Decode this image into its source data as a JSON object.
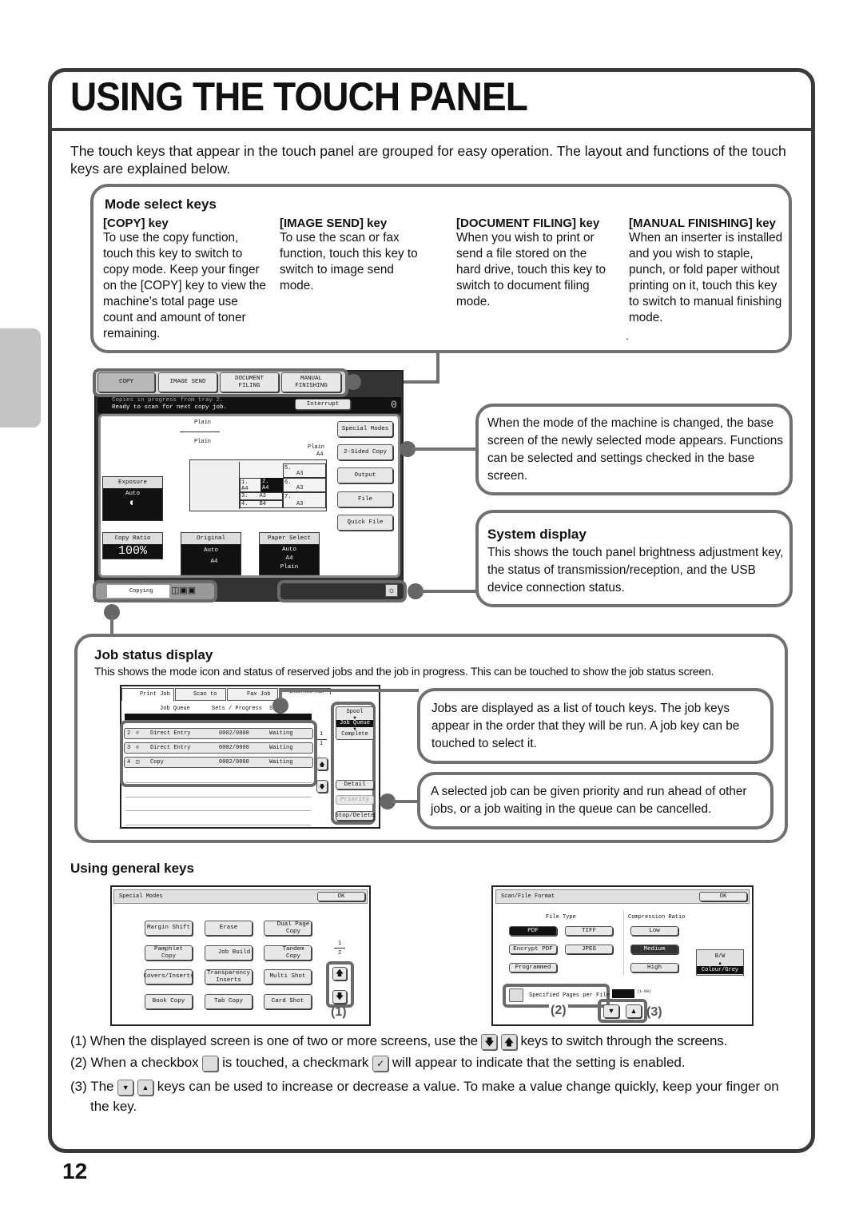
{
  "page": {
    "title": "USING THE TOUCH PANEL",
    "intro": "The touch keys that appear in the touch panel are grouped for easy operation. The layout and functions of the touch keys are explained below.",
    "page_number": "12"
  },
  "mode_select": {
    "heading": "Mode select keys",
    "columns": [
      {
        "title": "[COPY] key",
        "text": "To use the copy function, touch this key to switch to copy mode. Keep your finger on the [COPY] key to view the machine's total page use count and amount of toner remaining."
      },
      {
        "title": "[IMAGE SEND] key",
        "text": "To use the scan or fax function, touch this key to switch to image send mode."
      },
      {
        "title": "[DOCUMENT FILING] key",
        "text": "When you wish to print or send a file stored on the hard drive, touch this key to switch to document filing mode."
      },
      {
        "title": "[MANUAL FINISHING] key",
        "text": "When an inserter is installed and you wish to staple, punch, or fold paper without printing on it, touch this key to switch to manual finishing mode."
      }
    ],
    "trailing_dot": "."
  },
  "copy_screen": {
    "mode_keys": [
      "COPY",
      "IMAGE SEND",
      "DOCUMENT\nFILING",
      "MANUAL\nFINISHING"
    ],
    "message_line1": "Copies in progress from tray 2.",
    "message_line2": "Ready to scan for next copy job.",
    "interrupt": "Interrupt",
    "count": "0",
    "paper_labels": [
      "Plain",
      "Plain",
      "Plain"
    ],
    "bypass_size": "A4",
    "trays": [
      {
        "num": "1.",
        "size": "A4"
      },
      {
        "num": "2.",
        "size": "A4"
      },
      {
        "num": "3.",
        "size": "A3"
      },
      {
        "num": "4.",
        "size": "B4"
      },
      {
        "num": "5.",
        "size": "A3"
      },
      {
        "num": "6.",
        "size": "A3"
      },
      {
        "num": "7.",
        "size": "A3"
      }
    ],
    "right_keys": [
      "Special Modes",
      "2-Sided Copy",
      "Output",
      "File",
      "Quick File"
    ],
    "exposure": {
      "label": "Exposure",
      "value": "Auto"
    },
    "copy_ratio": {
      "label": "Copy Ratio",
      "value": "100%"
    },
    "original": {
      "label": "Original",
      "value": "Auto",
      "size": "A4"
    },
    "paper_select": {
      "label": "Paper Select",
      "line1": "Auto",
      "line2": "A4",
      "line3": "Plain"
    },
    "job_status": "Copying"
  },
  "base_screen_note": "When the mode of the machine is changed, the base screen of the newly selected mode appears. Functions can be selected and settings checked in the base screen.",
  "system_display": {
    "heading": "System display",
    "text": "This shows the touch panel brightness adjustment key, the status of transmission/reception, and the USB device connection status."
  },
  "job_status_display": {
    "heading": "Job status display",
    "text": "This shows the mode icon and status of reserved jobs and the job in progress. This can be touched to show the job status screen.",
    "tabs": [
      "Print Job",
      "Scan to",
      "Fax Job",
      "Internet Fax"
    ],
    "columns": [
      "Job Queue",
      "Sets / Progress",
      "Status"
    ],
    "rows": [
      {
        "num": "2",
        "name": "Direct Entry",
        "progress": "0002/0000",
        "status": "Waiting"
      },
      {
        "num": "3",
        "name": "Direct Entry",
        "progress": "0002/0000",
        "status": "Waiting"
      },
      {
        "num": "4",
        "name": "Copy",
        "progress": "0002/0000",
        "status": "Waiting"
      }
    ],
    "page_current": "1",
    "page_total": "1",
    "side_states": [
      "Spool",
      "Job Queue",
      "Complete"
    ],
    "side_buttons": [
      "Detail",
      "Priority",
      "Stop/Delete"
    ],
    "note1": "Jobs are displayed as a list of touch keys. The job keys appear in the order that they will be run. A job key can be touched to select it.",
    "note2": "A selected job can be given priority and run ahead of other jobs, or a job waiting in the queue can be cancelled."
  },
  "general_keys": {
    "heading": "Using general keys",
    "special_modes": {
      "title": "Special Modes",
      "ok": "OK",
      "buttons": [
        "Margin Shift",
        "Erase",
        "Dual Page Copy",
        "Pamphlet Copy",
        "Job Build",
        "Tandem Copy",
        "Covers/Inserts",
        "Transparency Inserts",
        "Multi Shot",
        "Book Copy",
        "Tab Copy",
        "Card Shot"
      ],
      "page_current": "1",
      "page_total": "2",
      "marker": "(1)"
    },
    "scan_format": {
      "title": "Scan/File Format",
      "ok": "OK",
      "file_type_label": "File Type",
      "file_types": [
        "PDF",
        "TIFF",
        "Encrypt PDF",
        "JPEG",
        "Programmed"
      ],
      "compression_label": "Compression Ratio",
      "compressions": [
        "Low",
        "Medium",
        "High"
      ],
      "bw": "B/W",
      "colour": "Colour/Grey",
      "checkbox_label": "Specified Pages per File",
      "range": "(1-99)",
      "marker2": "(2)",
      "marker3": "(3)"
    },
    "notes": [
      {
        "num": "(1)",
        "pre": "When the displayed screen is one of two or more screens, use the",
        "post": "keys to switch through the screens."
      },
      {
        "num": "(2)",
        "pre": "When a checkbox",
        "mid": "is touched, a checkmark",
        "post": "will appear to indicate that the setting is enabled."
      },
      {
        "num": "(3)",
        "pre": "The",
        "post": "keys can be used to increase or decrease a value. To make a value change quickly, keep your finger on the key."
      }
    ]
  }
}
